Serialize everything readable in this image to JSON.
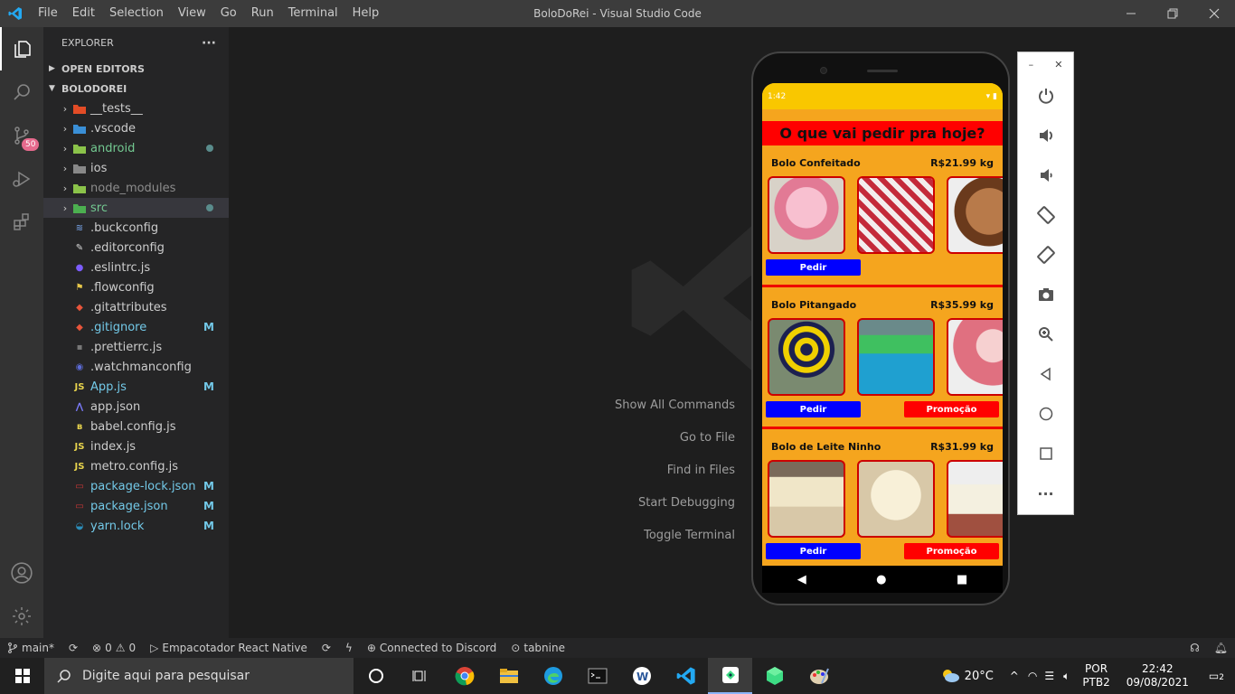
{
  "window": {
    "title": "BoloDoRei - Visual Studio Code",
    "menu": [
      "File",
      "Edit",
      "Selection",
      "View",
      "Go",
      "Run",
      "Terminal",
      "Help"
    ]
  },
  "activity": {
    "scm_badge": "50"
  },
  "explorer": {
    "title": "EXPLORER",
    "more": "···",
    "open_editors": "OPEN EDITORS",
    "project": "BOLODOREI",
    "items": [
      {
        "name": "__tests__",
        "folder": true,
        "color": "#cccccc",
        "icon_color": "#e34c26",
        "badge": ""
      },
      {
        "name": ".vscode",
        "folder": true,
        "color": "#cccccc",
        "icon_color": "#3a8fd6",
        "badge": ""
      },
      {
        "name": "android",
        "folder": true,
        "color": "#73c991",
        "icon_color": "#8bc34a",
        "badge": "dot"
      },
      {
        "name": "ios",
        "folder": true,
        "color": "#cccccc",
        "icon_color": "#888888",
        "badge": ""
      },
      {
        "name": "node_modules",
        "folder": true,
        "color": "#8c8c8c",
        "icon_color": "#8bc34a",
        "badge": ""
      },
      {
        "name": "src",
        "folder": true,
        "color": "#73c991",
        "icon_color": "#4caf50",
        "badge": "dot",
        "selected": true
      },
      {
        "name": ".buckconfig",
        "folder": false,
        "color": "#cccccc",
        "icon_color": "#6a8fc8",
        "icon": "≋",
        "badge": ""
      },
      {
        "name": ".editorconfig",
        "folder": false,
        "color": "#cccccc",
        "icon_color": "#dddddd",
        "icon": "✎",
        "badge": ""
      },
      {
        "name": ".eslintrc.js",
        "folder": false,
        "color": "#cccccc",
        "icon_color": "#7c5cff",
        "icon": "●",
        "badge": ""
      },
      {
        "name": ".flowconfig",
        "folder": false,
        "color": "#cccccc",
        "icon_color": "#e8c84a",
        "icon": "⚑",
        "badge": ""
      },
      {
        "name": ".gitattributes",
        "folder": false,
        "color": "#cccccc",
        "icon_color": "#e8553b",
        "icon": "◆",
        "badge": ""
      },
      {
        "name": ".gitignore",
        "folder": false,
        "color": "#73c9e8",
        "icon_color": "#e8553b",
        "icon": "◆",
        "badge": "M"
      },
      {
        "name": ".prettierrc.js",
        "folder": false,
        "color": "#cccccc",
        "icon_color": "#777777",
        "icon": "▪",
        "badge": ""
      },
      {
        "name": ".watchmanconfig",
        "folder": false,
        "color": "#cccccc",
        "icon_color": "#5c6bd6",
        "icon": "◉",
        "badge": ""
      },
      {
        "name": "App.js",
        "folder": false,
        "color": "#73c9e8",
        "icon_color": "#e8d44d",
        "icon": "JS",
        "badge": "M"
      },
      {
        "name": "app.json",
        "folder": false,
        "color": "#cccccc",
        "icon_color": "#7c7cff",
        "icon": "⋀",
        "badge": ""
      },
      {
        "name": "babel.config.js",
        "folder": false,
        "color": "#cccccc",
        "icon_color": "#e8d44d",
        "icon": "ʙ",
        "badge": ""
      },
      {
        "name": "index.js",
        "folder": false,
        "color": "#cccccc",
        "icon_color": "#e8d44d",
        "icon": "JS",
        "badge": ""
      },
      {
        "name": "metro.config.js",
        "folder": false,
        "color": "#cccccc",
        "icon_color": "#e8d44d",
        "icon": "JS",
        "badge": ""
      },
      {
        "name": "package-lock.json",
        "folder": false,
        "color": "#73c9e8",
        "icon_color": "#cb3837",
        "icon": "▭",
        "badge": "M"
      },
      {
        "name": "package.json",
        "folder": false,
        "color": "#73c9e8",
        "icon_color": "#cb3837",
        "icon": "▭",
        "badge": "M"
      },
      {
        "name": "yarn.lock",
        "folder": false,
        "color": "#73c9e8",
        "icon_color": "#2c8ebb",
        "icon": "◒",
        "badge": "M"
      }
    ]
  },
  "editor": {
    "shortcuts": [
      "Show All Commands",
      "Go to File",
      "Find in Files",
      "Start Debugging",
      "Toggle Terminal"
    ]
  },
  "phone": {
    "time": "1:42",
    "header": "O que vai pedir pra hoje?",
    "cakes": [
      {
        "name": "Bolo Confeitado",
        "price": "R$21.99 kg",
        "order": "Pedir",
        "promo": ""
      },
      {
        "name": "Bolo Pitangado",
        "price": "R$35.99 kg",
        "order": "Pedir",
        "promo": "Promoção"
      },
      {
        "name": "Bolo de Leite Ninho",
        "price": "R$31.99 kg",
        "order": "Pedir",
        "promo": "Promoção"
      }
    ]
  },
  "statusbar": {
    "branch": "main*",
    "errors": "0",
    "warnings": "0",
    "run": "Empacotador React Native",
    "discord": "Connected to Discord",
    "tabnine": "tabnine"
  },
  "taskbar": {
    "search_placeholder": "Digite aqui para pesquisar",
    "weather": "20°C",
    "lang1": "POR",
    "lang2": "PTB2",
    "time": "22:42",
    "date": "09/08/2021",
    "notif": "2"
  }
}
